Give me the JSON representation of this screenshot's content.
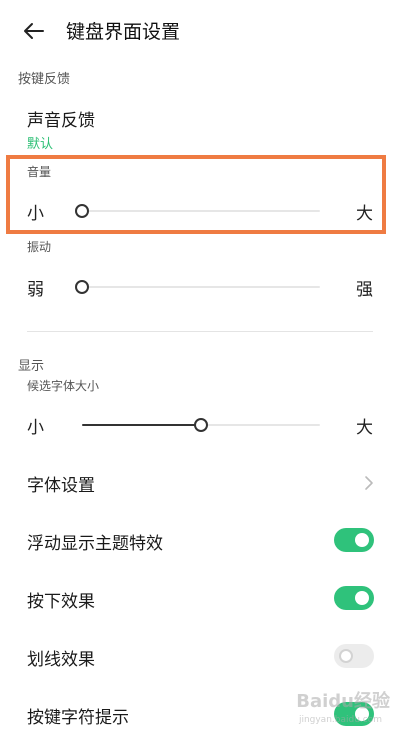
{
  "header": {
    "title": "键盘界面设置",
    "back_icon": "arrow-left-icon"
  },
  "feedback_section": {
    "label": "按键反馈",
    "sound_feedback": {
      "label": "声音反馈",
      "value": "默认"
    },
    "volume": {
      "label": "音量",
      "min_label": "小",
      "max_label": "大",
      "value": 0
    },
    "vibration": {
      "label": "振动",
      "min_label": "弱",
      "max_label": "强",
      "value": 0
    }
  },
  "display_section": {
    "label": "显示",
    "candidate_font_size": {
      "label": "候选字体大小",
      "min_label": "小",
      "max_label": "大",
      "value": 0.5
    },
    "items": [
      {
        "label": "字体设置",
        "type": "link"
      },
      {
        "label": "浮动显示主题特效",
        "type": "switch",
        "on": true
      },
      {
        "label": "按下效果",
        "type": "switch",
        "on": true
      },
      {
        "label": "划线效果",
        "type": "switch",
        "on": false
      },
      {
        "label": "按键字符提示",
        "type": "switch",
        "on": true
      }
    ]
  },
  "colors": {
    "accent": "#2fc27b",
    "highlight": "#ef7b42"
  },
  "watermark": {
    "text": "Baidu经验",
    "sub": "jingyan.baidu.com"
  }
}
